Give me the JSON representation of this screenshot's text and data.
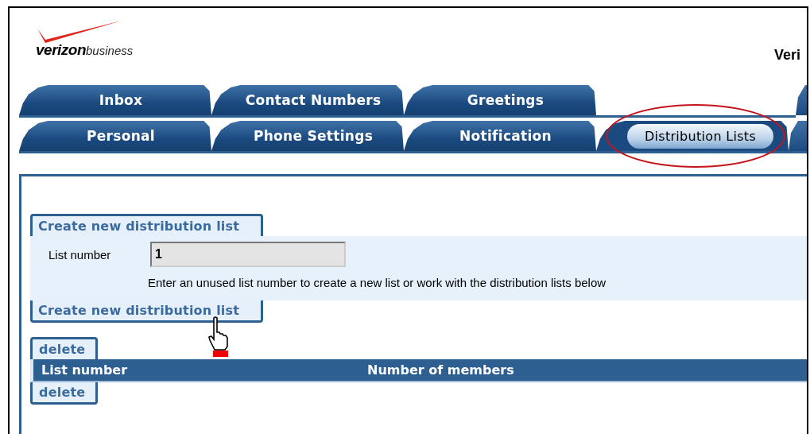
{
  "header": {
    "brand": "verizon",
    "brand_suffix": "business",
    "title": "Veri"
  },
  "tab_rows": [
    {
      "tabs": [
        {
          "label": "Inbox",
          "selected": false,
          "circled": false
        },
        {
          "label": "Contact Numbers",
          "selected": false,
          "circled": false
        },
        {
          "label": "Greetings",
          "selected": false,
          "circled": false
        }
      ]
    },
    {
      "tabs": [
        {
          "label": "Personal",
          "selected": false,
          "circled": false
        },
        {
          "label": "Phone Settings",
          "selected": false,
          "circled": false
        },
        {
          "label": "Notification",
          "selected": false,
          "circled": false
        },
        {
          "label": "Distribution Lists",
          "selected": true,
          "circled": true
        }
      ]
    }
  ],
  "create_form": {
    "top_button": "Create new distribution list",
    "field_label": "List number",
    "field_value": "1",
    "hint": "Enter an unused list number to create a new list or work with the distribution lists below",
    "bottom_button": "Create new distribution list"
  },
  "lists": {
    "top_button": "delete",
    "columns": [
      "List number",
      "Number of members"
    ],
    "bottom_button": "delete"
  }
}
